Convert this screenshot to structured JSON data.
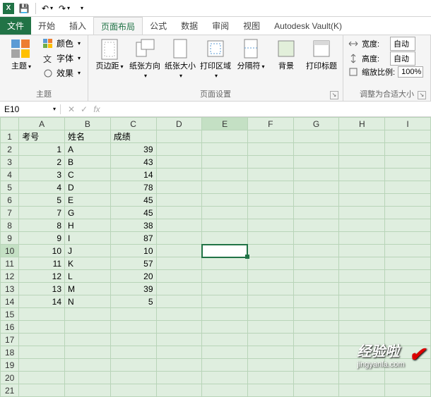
{
  "qat": {
    "app_glyph": "X",
    "save": "💾",
    "undo": "↶",
    "redo": "↷"
  },
  "tabs": {
    "file": "文件",
    "home": "开始",
    "insert": "插入",
    "page_layout": "页面布局",
    "formulas": "公式",
    "data": "数据",
    "review": "审阅",
    "view": "视图",
    "addin": "Autodesk Vault(K)"
  },
  "ribbon": {
    "themes": {
      "theme": "主题",
      "colors": "颜色",
      "fonts": "字体",
      "effects": "效果",
      "label": "主题"
    },
    "page_setup": {
      "margins": "页边距",
      "orientation": "纸张方向",
      "size": "纸张大小",
      "print_area": "打印区域",
      "breaks": "分隔符",
      "background": "背景",
      "print_titles": "打印标题",
      "label": "页面设置"
    },
    "scale": {
      "width_label": "宽度:",
      "width_value": "自动",
      "height_label": "高度:",
      "height_value": "自动",
      "scale_label": "缩放比例:",
      "scale_value": "100%",
      "label": "调整为合适大小"
    }
  },
  "namebox": "E10",
  "fx": "fx",
  "columns": [
    "A",
    "B",
    "C",
    "D",
    "E",
    "F",
    "G",
    "H",
    "I"
  ],
  "headers": {
    "A": "考号",
    "B": "姓名",
    "C": "成绩"
  },
  "rows": [
    {
      "n": 1,
      "A": "1",
      "B": "A",
      "C": "39"
    },
    {
      "n": 2,
      "A": "2",
      "B": "B",
      "C": "43"
    },
    {
      "n": 3,
      "A": "3",
      "B": "C",
      "C": "14"
    },
    {
      "n": 4,
      "A": "4",
      "B": "D",
      "C": "78"
    },
    {
      "n": 5,
      "A": "5",
      "B": "E",
      "C": "45"
    },
    {
      "n": 6,
      "A": "7",
      "B": "G",
      "C": "45"
    },
    {
      "n": 7,
      "A": "8",
      "B": "H",
      "C": "38"
    },
    {
      "n": 8,
      "A": "9",
      "B": "I",
      "C": "87"
    },
    {
      "n": 9,
      "A": "10",
      "B": "J",
      "C": "10"
    },
    {
      "n": 10,
      "A": "11",
      "B": "K",
      "C": "57"
    },
    {
      "n": 11,
      "A": "12",
      "B": "L",
      "C": "20"
    },
    {
      "n": 12,
      "A": "13",
      "B": "M",
      "C": "39"
    },
    {
      "n": 13,
      "A": "14",
      "B": "N",
      "C": "5"
    }
  ],
  "total_rows": 21,
  "selected_cell": "E10",
  "watermark": {
    "brand": "经验啦",
    "url": "jingyanla.com"
  }
}
